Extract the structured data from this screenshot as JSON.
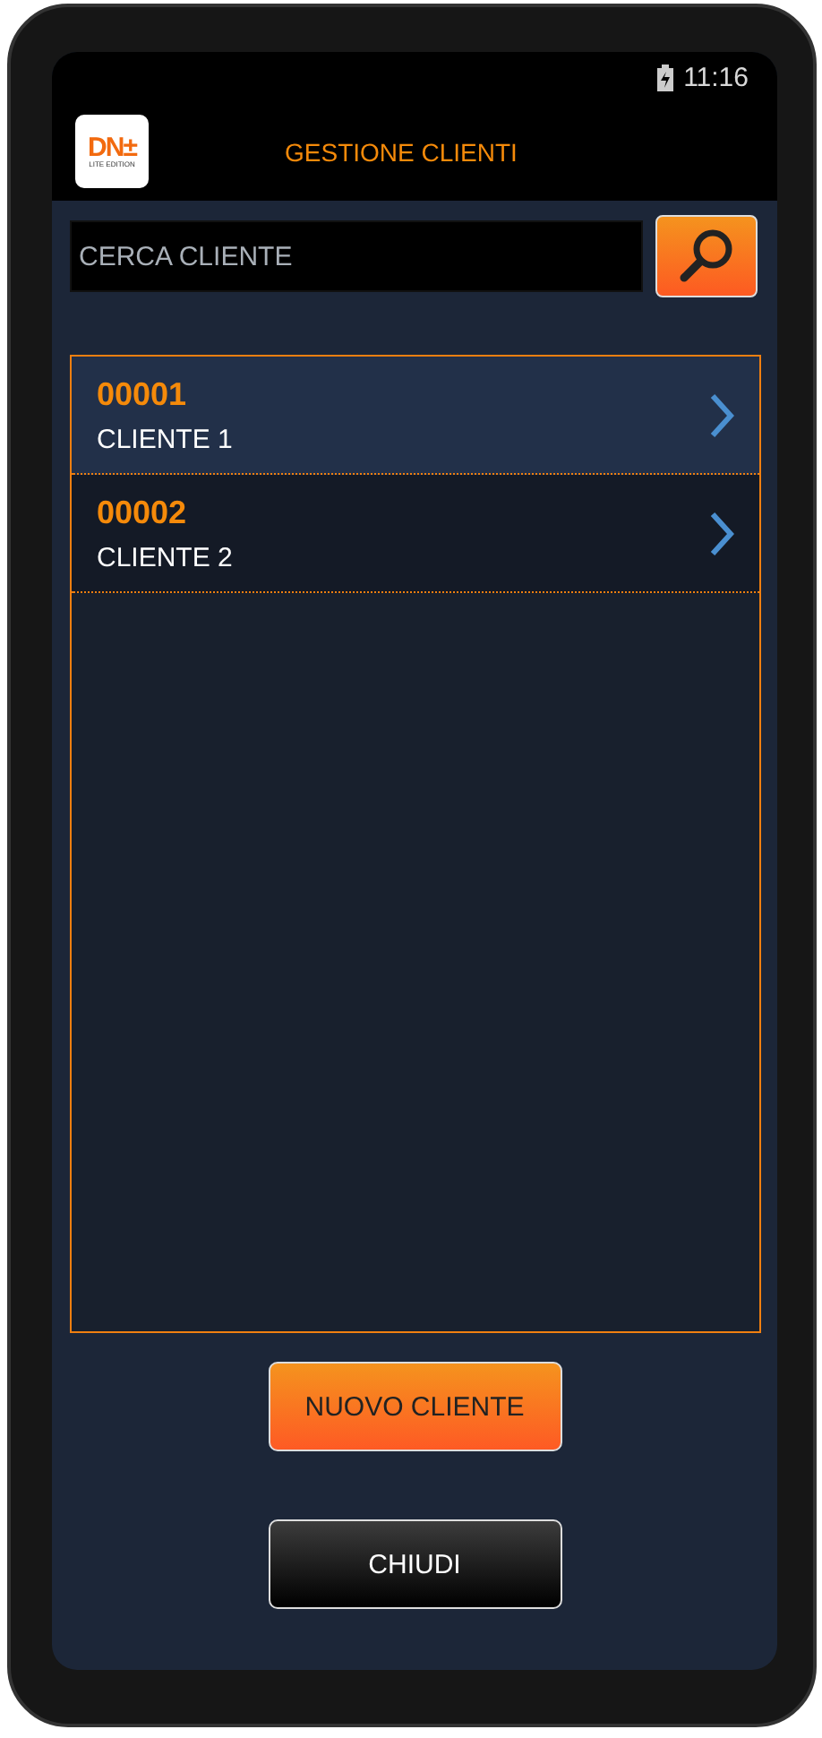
{
  "status_bar": {
    "time": "11:16"
  },
  "header": {
    "logo": {
      "mark": "DN±",
      "subtitle": "LITE EDITION"
    },
    "title": "GESTIONE CLIENTI"
  },
  "search": {
    "placeholder": "CERCA CLIENTE"
  },
  "clients": [
    {
      "code": "00001",
      "name": "CLIENTE 1",
      "selected": true
    },
    {
      "code": "00002",
      "name": "CLIENTE 2",
      "selected": false
    }
  ],
  "buttons": [
    {
      "label": "NUOVO CLIENTE",
      "kind": "primary"
    },
    {
      "label": "CHIUDI",
      "kind": "secondary"
    }
  ]
}
